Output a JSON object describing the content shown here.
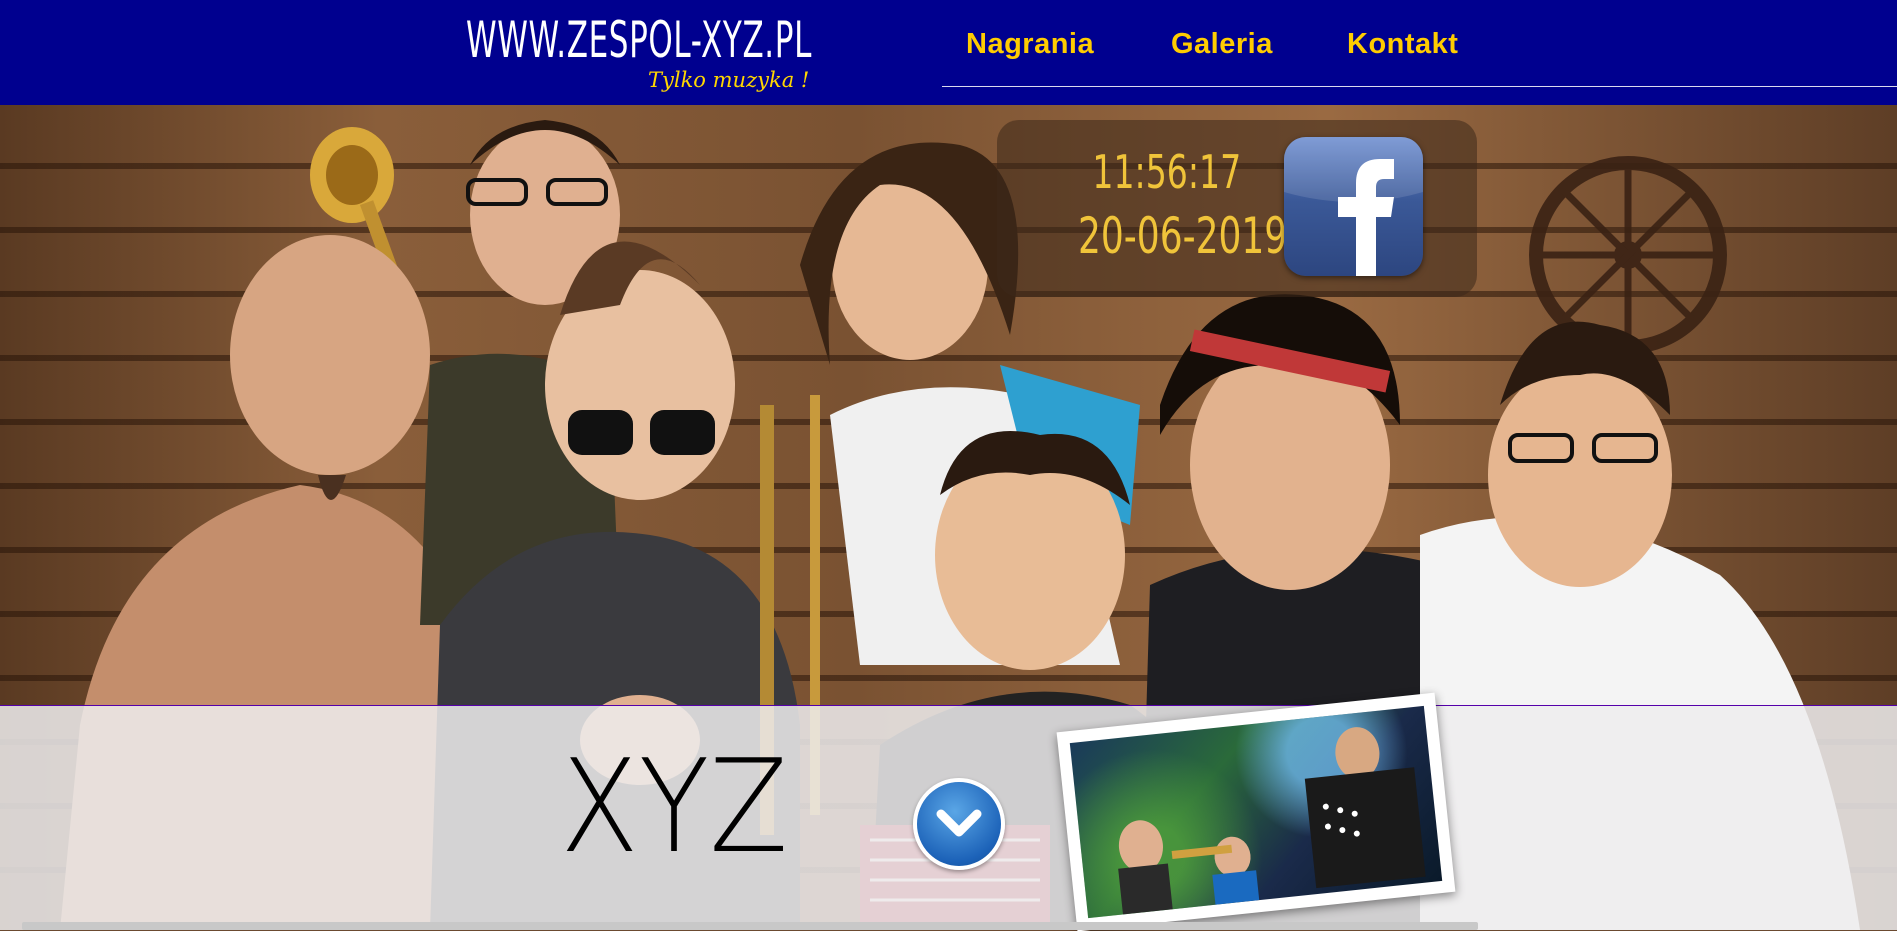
{
  "header": {
    "logo": "WWW.ZESPOL-XYZ.PL",
    "tagline": "Tylko muzyka !",
    "nav": [
      {
        "label": "Nagrania"
      },
      {
        "label": "Galeria"
      },
      {
        "label": "Kontakt"
      }
    ]
  },
  "widget": {
    "time": "11:56:17",
    "date": "20-06-2019",
    "facebook_icon": "facebook-icon"
  },
  "panel": {
    "band_name": "XYZ",
    "scroll_icon": "chevron-down-icon"
  },
  "colors": {
    "header_bg": "#00008f",
    "nav_link": "#ffcc00",
    "clock_text": "#f0c43a",
    "facebook_blue": "#3b5998"
  }
}
